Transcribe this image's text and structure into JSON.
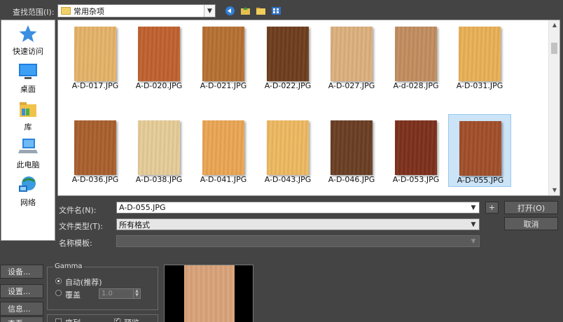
{
  "lookin": {
    "label": "查找范围(I):",
    "value": "常用杂项"
  },
  "places": [
    {
      "label": "快速访问",
      "icon": "star-icon"
    },
    {
      "label": "桌面",
      "icon": "desktop-icon"
    },
    {
      "label": "库",
      "icon": "library-icon"
    },
    {
      "label": "此电脑",
      "icon": "computer-icon"
    },
    {
      "label": "网络",
      "icon": "network-icon"
    }
  ],
  "files": [
    {
      "name": "A-D-017.JPG",
      "color": "#e8b569"
    },
    {
      "name": "A-D-020.JPG",
      "color": "#c2612e"
    },
    {
      "name": "A-D-021.JPG",
      "color": "#b87132"
    },
    {
      "name": "A-D-022.JPG",
      "color": "#6e3d1c"
    },
    {
      "name": "A-D-027.JPG",
      "color": "#dfb27f"
    },
    {
      "name": "A-d-028.JPG",
      "color": "#c48e5f"
    },
    {
      "name": "A-D-031.JPG",
      "color": "#ecb256"
    },
    {
      "name": "A-D-036.JPG",
      "color": "#ab5f2c"
    },
    {
      "name": "A-D-038.JPG",
      "color": "#e9cf99"
    },
    {
      "name": "A-D-041.JPG",
      "color": "#eea754"
    },
    {
      "name": "A-D-043.JPG",
      "color": "#f1bb61"
    },
    {
      "name": "A-D-046.JPG",
      "color": "#6a3d22"
    },
    {
      "name": "A-D-053.JPG",
      "color": "#7d2f1a"
    },
    {
      "name": "A-D-055.JPG",
      "color": "#a34e28",
      "selected": true
    }
  ],
  "filename": {
    "label": "文件名(N):",
    "value": "A-D-055.JPG"
  },
  "filetype": {
    "label": "文件类型(T):",
    "value": "所有格式"
  },
  "template": {
    "label": "名称模板:",
    "value": ""
  },
  "buttons": {
    "plus": "+",
    "open": "打开(O)",
    "cancel": "取消"
  },
  "side_buttons": [
    "设备...",
    "设置...",
    "信息...",
    "查看"
  ],
  "gamma": {
    "title": "Gamma",
    "auto": "自动(推荐)",
    "override": "覆盖",
    "override_value": "1.0"
  },
  "checkboxes": [
    {
      "label": "序列",
      "checked": false
    },
    {
      "label": "预览",
      "checked": true
    }
  ],
  "preview_color": "#dba47a"
}
